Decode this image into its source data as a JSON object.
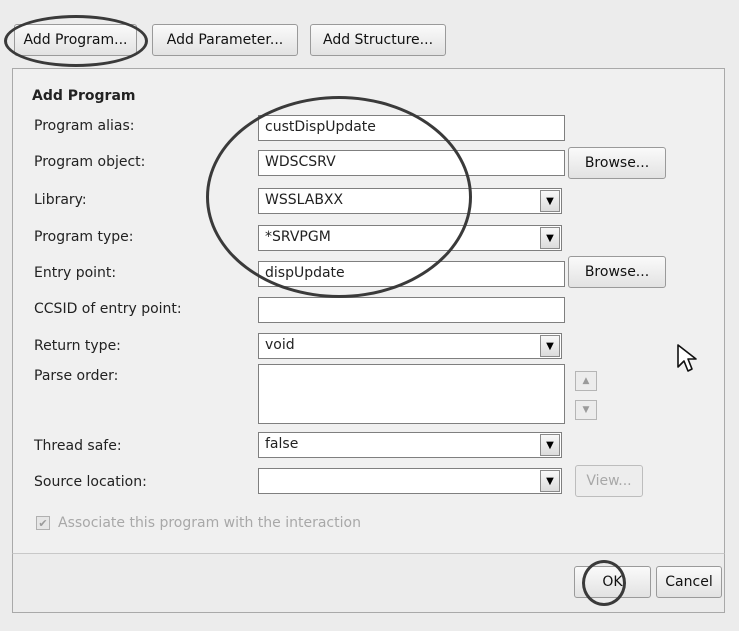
{
  "toolbar": {
    "add_program": "Add Program...",
    "add_parameter": "Add Parameter...",
    "add_structure": "Add Structure..."
  },
  "section_title": "Add Program",
  "form": {
    "program_alias": {
      "label": "Program alias:",
      "value": "custDispUpdate"
    },
    "program_object": {
      "label": "Program object:",
      "value": "WDSCSRV",
      "browse": "Browse..."
    },
    "library": {
      "label": "Library:",
      "value": "WSSLABXX"
    },
    "program_type": {
      "label": "Program type:",
      "value": "*SRVPGM"
    },
    "entry_point": {
      "label": "Entry point:",
      "value": "dispUpdate",
      "browse": "Browse..."
    },
    "ccsid": {
      "label": "CCSID of entry point:",
      "value": ""
    },
    "return_type": {
      "label": "Return type:",
      "value": "void"
    },
    "parse_order": {
      "label": "Parse order:"
    },
    "thread_safe": {
      "label": "Thread safe:",
      "value": "false"
    },
    "source_location": {
      "label": "Source location:",
      "value": "",
      "view": "View..."
    }
  },
  "associate_checkbox": {
    "label": "Associate this program with the interaction",
    "checked": true
  },
  "buttons": {
    "ok": "OK",
    "cancel": "Cancel"
  }
}
